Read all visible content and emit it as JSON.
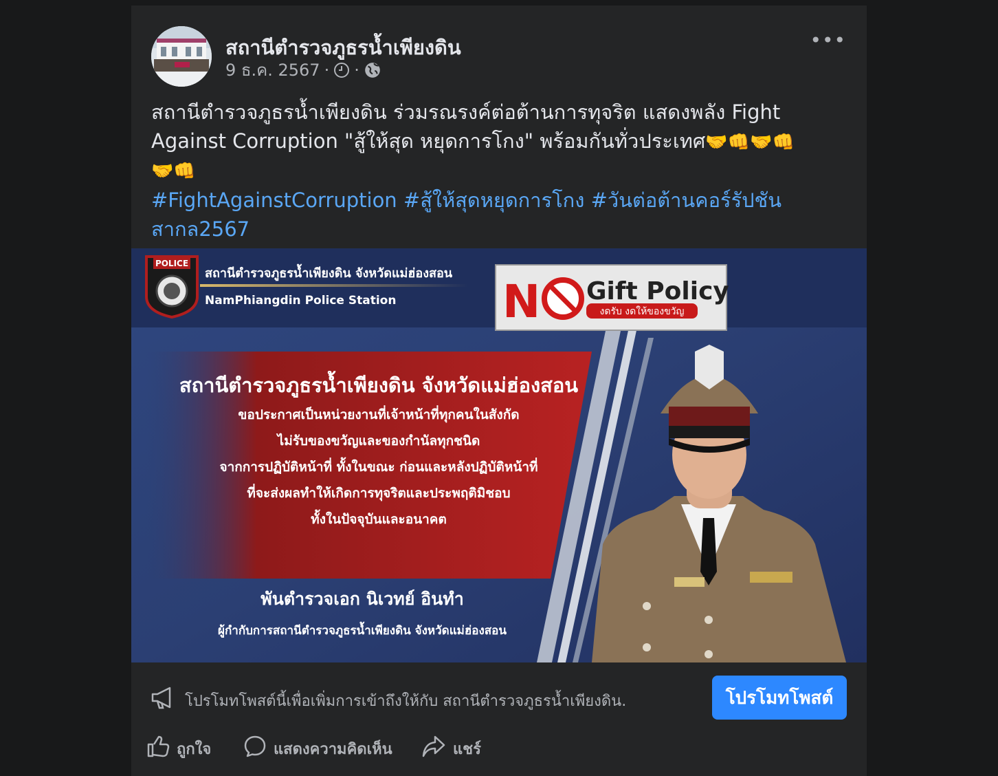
{
  "post": {
    "page_name": "สถานีตำรวจภูธรน้ำเพียงดิน",
    "date": "9 ธ.ค. 2567",
    "body_line1": "สถานีตำรวจภูธรน้ำเพียงดิน ร่วมรณรงค์ต่อต้านการทุจริต แสดงพลัง Fight",
    "body_line2": "Against Corruption \"สู้ให้สุด หยุดการโกง\" พร้อมกันทั่วประเทศ",
    "emoji_line2": "🤝👊🤝👊",
    "emoji_line3": "🤝👊",
    "hashtags_line1": "#FightAgainstCorruption #สู้ให้สุดหยุดการโกง #วันต่อต้านคอร์รัปชัน",
    "hashtags_line2": "สากล2567"
  },
  "image": {
    "header_th": "สถานีตำรวจภูธรน้ำเพียงดิน จังหวัดแม่ฮ่องสอน",
    "header_en": "NamPhiangdin Police Station",
    "police_badge": "POLICE",
    "no_gift_n": "N",
    "no_gift_title": "Gift Policy",
    "no_gift_sub": "งดรับ งดให้ของขวัญ",
    "headline": "สถานีตำรวจภูธรน้ำเพียงดิน จังหวัดแม่ฮ่องสอน",
    "line1": "ขอประกาศเป็นหน่วยงานที่เจ้าหน้าที่ทุกคนในสังกัด",
    "line2": "ไม่รับของขวัญและของกำนัลทุกชนิด",
    "line3": "จากการปฏิบัติหน้าที่ ทั้งในขณะ ก่อนและหลังปฏิบัติหน้าที่",
    "line4": "ที่จะส่งผลทำให้เกิดการทุจริตและประพฤติมิชอบ",
    "line5": "ทั้งในปัจจุบันและอนาคต",
    "officer_name": "พันตำรวจเอก นิเวทย์ อินทำ",
    "officer_title": "ผู้กำกับการสถานีตำรวจภูธรน้ำเพียงดิน จังหวัดแม่ฮ่องสอน"
  },
  "promo": {
    "text": "โปรโมทโพสต์นี้เพื่อเพิ่มการเข้าถึงให้กับ สถานีตำรวจภูธรน้ำเพียงดิน.",
    "button": "โปรโมทโพสต์"
  },
  "actions": {
    "like": "ถูกใจ",
    "comment": "แสดงความคิดเห็น",
    "share": "แชร์"
  },
  "icons": [
    "clock-icon",
    "globe-icon",
    "more-options-icon",
    "megaphone-icon",
    "like-icon",
    "comment-icon",
    "share-icon"
  ],
  "colors": {
    "background": "#18191a",
    "card": "#242526",
    "link": "#5aa7f5",
    "button": "#2d88ff"
  }
}
